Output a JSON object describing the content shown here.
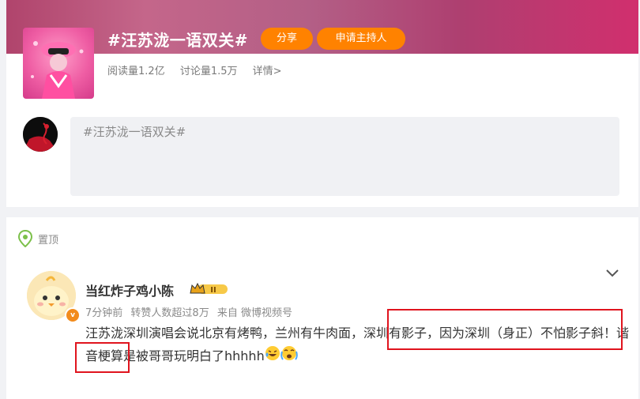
{
  "topic": {
    "title": "#汪苏泷一语双关#",
    "share_label": "分享",
    "host_label": "申请主持人",
    "reads": "阅读量1.2亿",
    "discussions": "讨论量1.5万",
    "detail_link": "详情>"
  },
  "composer": {
    "text": "#汪苏泷一语双关#"
  },
  "feed": {
    "pinned_label": "置顶",
    "post": {
      "username": "当红炸子鸡小陈",
      "vip_level": "II",
      "time": "7分钟前",
      "reposts": "转赞人数超过8万",
      "source": "来自 微博视频号",
      "text": "汪苏泷深圳演唱会说北京有烤鸭，兰州有牛肉面，深圳有影子，因为深圳（身正）不怕影子斜！谐音梗算是被哥哥玩明白了hhhhh"
    }
  },
  "colors": {
    "accent_orange": "#ff8200",
    "highlight_red": "#e0141e",
    "banner_pink": "#c4668a"
  }
}
